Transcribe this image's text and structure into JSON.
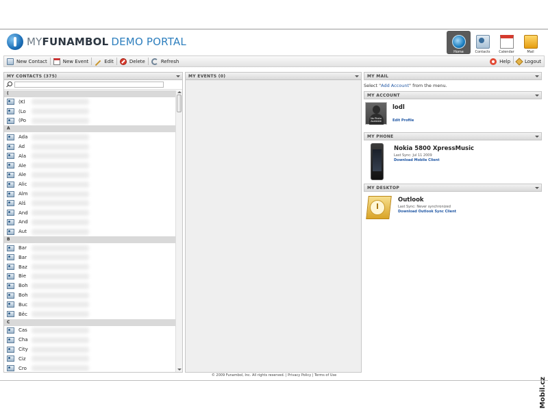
{
  "brand": {
    "my": "MY",
    "funambol": "FUNAMBOL",
    "demo": "DEMO PORTAL"
  },
  "topnav": [
    {
      "label": "Home",
      "icon": "home-icon",
      "active": true
    },
    {
      "label": "Contacts",
      "icon": "contacts-icon",
      "active": false
    },
    {
      "label": "Calendar",
      "icon": "calendar-icon",
      "active": false
    },
    {
      "label": "Mail",
      "icon": "mail-icon",
      "active": false
    }
  ],
  "toolbar": {
    "new_contact": "New Contact",
    "new_event": "New Event",
    "edit": "Edit",
    "delete": "Delete",
    "refresh": "Refresh",
    "help": "Help",
    "logout": "Logout"
  },
  "contacts": {
    "title": "MY CONTACTS (375)",
    "search_value": "",
    "groups": [
      {
        "letter": "(",
        "items": [
          "(Kl",
          "(Lo",
          "(Po"
        ]
      },
      {
        "letter": "A",
        "items": [
          "Ada",
          "Ad",
          "Ala",
          "Ale",
          "Ale",
          "Alic",
          "Alm",
          "Alš",
          "And",
          "And",
          "Aut"
        ]
      },
      {
        "letter": "B",
        "items": [
          "Bar",
          "Bar",
          "Baz",
          "Bie",
          "Boh",
          "Boh",
          "Buc",
          "Běc"
        ]
      },
      {
        "letter": "C",
        "items": [
          "Cas",
          "Cha",
          "City",
          "Ciz",
          "Cro"
        ]
      }
    ]
  },
  "events": {
    "title": "MY EVENTS (0)"
  },
  "mail": {
    "title": "MY MAIL",
    "text_before": "Select \"",
    "link": "Add Account",
    "text_after": "\" from the menu."
  },
  "account": {
    "title": "MY ACCOUNT",
    "username": "lodl",
    "avatar_text": "No Photo Available",
    "edit_link": "Edit Profile"
  },
  "phone": {
    "title": "MY PHONE",
    "model": "Nokia 5800 XpressMusic",
    "last_sync": "Last Sync: Jul 11 2009",
    "download_link": "Download Mobile Client"
  },
  "desktop": {
    "title": "MY DESKTOP",
    "app": "Outlook",
    "last_sync": "Last Sync: Never synchronized",
    "download_link": "Download Outlook Sync Client"
  },
  "footer": {
    "copyright": "© 2009 Funambol, Inc. All rights reserved.",
    "privacy": "Privacy Policy",
    "terms": "Terms of Use"
  },
  "watermark": "Mobil.cz"
}
